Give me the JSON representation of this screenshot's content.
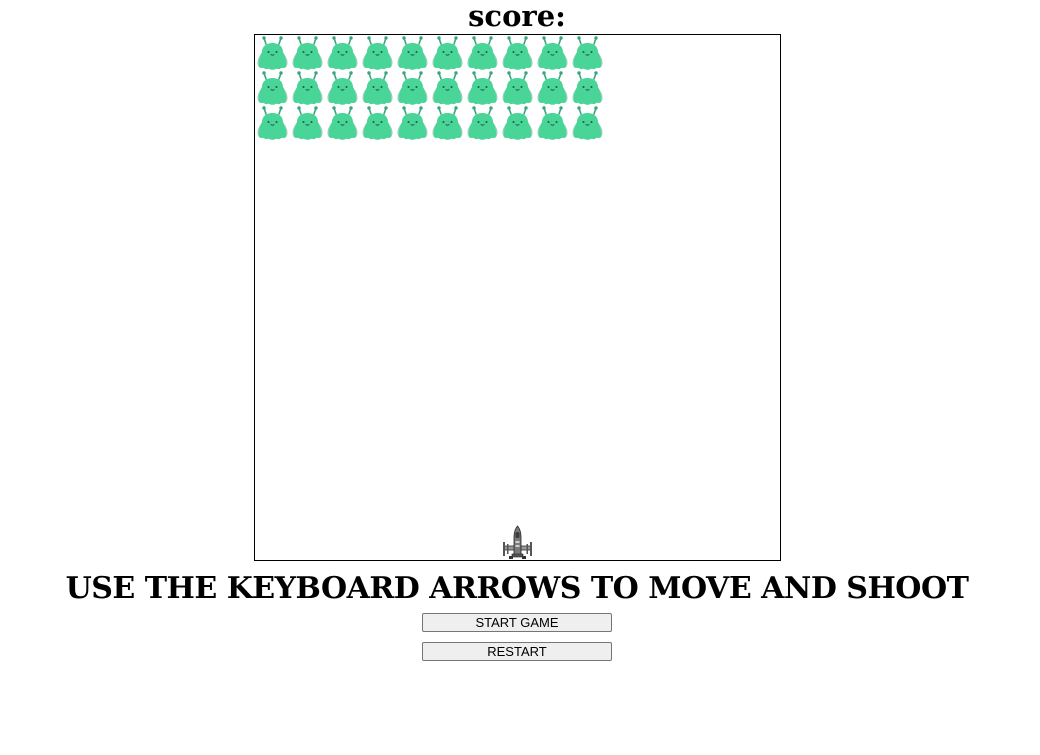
{
  "header": {
    "score_label": "score:"
  },
  "game": {
    "alien_rows": 3,
    "alien_cols": 10,
    "alien_color": "#48d597",
    "alien_antenna_color": "#3aa57d",
    "ship_color": "#6b6b6b"
  },
  "footer": {
    "instructions": "USE THE KEYBOARD ARROWS TO MOVE AND SHOOT",
    "start_label": "START GAME",
    "restart_label": "RESTART"
  }
}
